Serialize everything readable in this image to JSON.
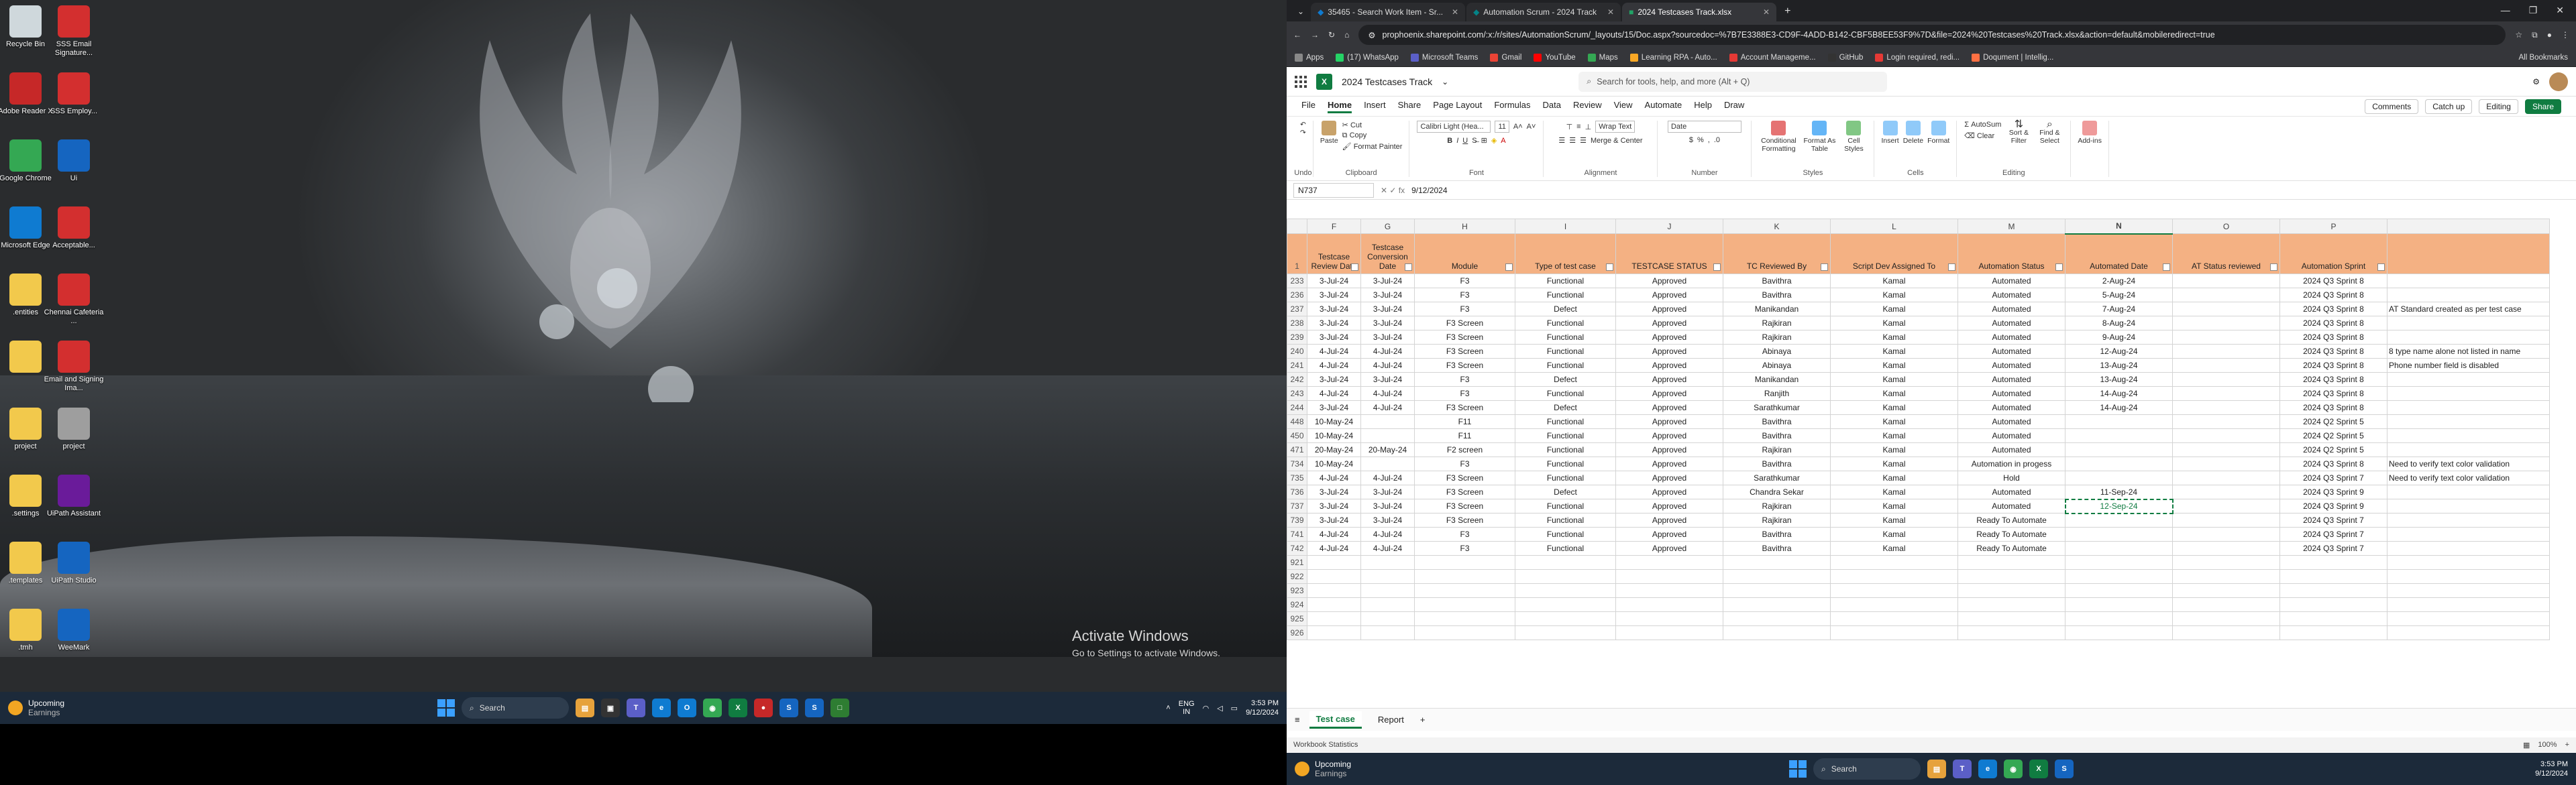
{
  "left_desktop": {
    "icons": [
      {
        "label": "Recycle Bin",
        "icon": "recycle-bin-icon",
        "color": "#cfd8dc"
      },
      {
        "label": "SSS Email Signature...",
        "icon": "pdf-icon",
        "color": "#d32f2f"
      },
      {
        "label": "Adobe Reader X",
        "icon": "adobe-reader-icon",
        "color": "#c62828"
      },
      {
        "label": "SSS Employ...",
        "icon": "pdf-icon",
        "color": "#d32f2f"
      },
      {
        "label": "Google Chrome",
        "icon": "chrome-icon",
        "color": "#34a853"
      },
      {
        "label": "Ui",
        "icon": "uipath-icon",
        "color": "#1565c0"
      },
      {
        "label": "Microsoft Edge",
        "icon": "edge-icon",
        "color": "#0f7bd1"
      },
      {
        "label": "Acceptable...",
        "icon": "pdf-icon",
        "color": "#d32f2f"
      },
      {
        "label": ".entities",
        "icon": "folder-icon",
        "color": "#f2c94c"
      },
      {
        "label": "Chennai Cafeteria ...",
        "icon": "pdf-icon",
        "color": "#d32f2f"
      },
      {
        "label": "",
        "icon": "folder-icon",
        "color": "#f2c94c"
      },
      {
        "label": "Email and Signing Ima...",
        "icon": "pdf-icon",
        "color": "#d32f2f"
      },
      {
        "label": "project",
        "icon": "folder-icon",
        "color": "#f2c94c"
      },
      {
        "label": "project",
        "icon": "file-icon",
        "color": "#9e9e9e"
      },
      {
        "label": ".settings",
        "icon": "folder-icon",
        "color": "#f2c94c"
      },
      {
        "label": "UiPath Assistant",
        "icon": "uipath-assistant-icon",
        "color": "#6a1b9a"
      },
      {
        "label": ".templates",
        "icon": "folder-icon",
        "color": "#f2c94c"
      },
      {
        "label": "UiPath Studio",
        "icon": "uipath-studio-icon",
        "color": "#1565c0"
      },
      {
        "label": ".tmh",
        "icon": "folder-icon",
        "color": "#f2c94c"
      },
      {
        "label": "WeeMark",
        "icon": "uipath-icon",
        "color": "#1565c0"
      }
    ],
    "activate_title": "Activate Windows",
    "activate_sub": "Go to Settings to activate Windows.",
    "taskbar": {
      "weather_title": "Upcoming",
      "weather_sub": "Earnings",
      "search": "Search",
      "lang": "ENG",
      "lang2": "IN",
      "time": "3:53 PM",
      "date": "9/12/2024"
    }
  },
  "browser": {
    "tabs": [
      {
        "label": "35465 - Search Work Item - Sr..."
      },
      {
        "label": "Automation Scrum - 2024 Track"
      },
      {
        "label": "2024 Testcases Track.xlsx"
      }
    ],
    "url": "prophoenix.sharepoint.com/:x:/r/sites/AutomationScrum/_layouts/15/Doc.aspx?sourcedoc=%7B7E3388E3-CD9F-4ADD-B142-CBF5B8EE53F9%7D&file=2024%20Testcases%20Track.xlsx&action=default&mobileredirect=true",
    "bookmarks": [
      "Apps",
      "(17) WhatsApp",
      "Microsoft Teams",
      "Gmail",
      "YouTube",
      "Maps",
      "Learning RPA - Auto...",
      "Account Manageme...",
      "GitHub",
      "Login required, redi...",
      "Doqument | Intellig..."
    ],
    "all_bookmarks": "All Bookmarks"
  },
  "excel": {
    "title": "2024 Testcases Track",
    "search_placeholder": "Search for tools, help, and more (Alt + Q)",
    "menu": [
      "File",
      "Home",
      "Insert",
      "Share",
      "Page Layout",
      "Formulas",
      "Data",
      "Review",
      "View",
      "Automate",
      "Help",
      "Draw"
    ],
    "menu_right": {
      "comments": "Comments",
      "catchup": "Catch up",
      "editing": "Editing",
      "share": "Share"
    },
    "ribbon": {
      "undo": "Undo",
      "paste": "Paste",
      "cut": "Cut",
      "copy": "Copy",
      "format_painter": "Format Painter",
      "clipboard": "Clipboard",
      "font_name": "Calibri Light (Hea...",
      "font_size": "11",
      "font": "Font",
      "wrap_text": "Wrap Text",
      "merge_center": "Merge & Center",
      "alignment": "Alignment",
      "number_format": "Date",
      "number": "Number",
      "cond_format": "Conditional Formatting",
      "format_table": "Format As Table",
      "cell_styles": "Cell Styles",
      "styles": "Styles",
      "insert": "Insert",
      "delete": "Delete",
      "format": "Format",
      "cells": "Cells",
      "autosum": "AutoSum",
      "clear": "Clear",
      "sort_filter": "Sort & Filter",
      "find_select": "Find & Select",
      "editing": "Editing",
      "addins": "Add-ins"
    },
    "namebox": "N737",
    "formula": "9/12/2024",
    "columns": [
      "F",
      "G",
      "H",
      "I",
      "J",
      "K",
      "L",
      "M",
      "N",
      "O",
      "P"
    ],
    "headers": [
      "Testcase Review Date",
      "Testcase Conversion Date",
      "Module",
      "Type of test case",
      "TESTCASE STATUS",
      "TC Reviewed By",
      "Script Dev Assigned To",
      "Automation Status",
      "Automated Date",
      "AT Status reviewed",
      "Automation Sprint",
      ""
    ],
    "rows": [
      [
        "233",
        "3-Jul-24",
        "3-Jul-24",
        "F3",
        "Functional",
        "Approved",
        "Bavithra",
        "Kamal",
        "Automated",
        "2-Aug-24",
        "",
        "2024 Q3 Sprint 8",
        ""
      ],
      [
        "236",
        "3-Jul-24",
        "3-Jul-24",
        "F3",
        "Functional",
        "Approved",
        "Bavithra",
        "Kamal",
        "Automated",
        "5-Aug-24",
        "",
        "2024 Q3 Sprint 8",
        ""
      ],
      [
        "237",
        "3-Jul-24",
        "3-Jul-24",
        "F3",
        "Defect",
        "Approved",
        "Manikandan",
        "Kamal",
        "Automated",
        "7-Aug-24",
        "",
        "2024 Q3 Sprint 8",
        "AT Standard created as per test case"
      ],
      [
        "238",
        "3-Jul-24",
        "3-Jul-24",
        "F3 Screen",
        "Functional",
        "Approved",
        "Rajkiran",
        "Kamal",
        "Automated",
        "8-Aug-24",
        "",
        "2024 Q3 Sprint 8",
        ""
      ],
      [
        "239",
        "3-Jul-24",
        "3-Jul-24",
        "F3 Screen",
        "Functional",
        "Approved",
        "Rajkiran",
        "Kamal",
        "Automated",
        "9-Aug-24",
        "",
        "2024 Q3 Sprint 8",
        ""
      ],
      [
        "240",
        "4-Jul-24",
        "4-Jul-24",
        "F3 Screen",
        "Functional",
        "Approved",
        "Abinaya",
        "Kamal",
        "Automated",
        "12-Aug-24",
        "",
        "2024 Q3 Sprint 8",
        "8 type name alone not listed in name"
      ],
      [
        "241",
        "4-Jul-24",
        "4-Jul-24",
        "F3 Screen",
        "Functional",
        "Approved",
        "Abinaya",
        "Kamal",
        "Automated",
        "13-Aug-24",
        "",
        "2024 Q3 Sprint 8",
        "Phone number field is disabled"
      ],
      [
        "242",
        "3-Jul-24",
        "3-Jul-24",
        "F3",
        "Defect",
        "Approved",
        "Manikandan",
        "Kamal",
        "Automated",
        "13-Aug-24",
        "",
        "2024 Q3 Sprint 8",
        ""
      ],
      [
        "243",
        "4-Jul-24",
        "4-Jul-24",
        "F3",
        "Functional",
        "Approved",
        "Ranjith",
        "Kamal",
        "Automated",
        "14-Aug-24",
        "",
        "2024 Q3 Sprint 8",
        ""
      ],
      [
        "244",
        "3-Jul-24",
        "4-Jul-24",
        "F3 Screen",
        "Defect",
        "Approved",
        "Sarathkumar",
        "Kamal",
        "Automated",
        "14-Aug-24",
        "",
        "2024 Q3 Sprint 8",
        ""
      ],
      [
        "448",
        "10-May-24",
        "",
        "F11",
        "Functional",
        "Approved",
        "Bavithra",
        "Kamal",
        "Automated",
        "",
        "",
        "2024 Q2 Sprint 5",
        ""
      ],
      [
        "450",
        "10-May-24",
        "",
        "F11",
        "Functional",
        "Approved",
        "Bavithra",
        "Kamal",
        "Automated",
        "",
        "",
        "2024 Q2 Sprint 5",
        ""
      ],
      [
        "471",
        "20-May-24",
        "20-May-24",
        "F2 screen",
        "Functional",
        "Approved",
        "Rajkiran",
        "Kamal",
        "Automated",
        "",
        "",
        "2024 Q2 Sprint 5",
        ""
      ],
      [
        "734",
        "10-May-24",
        "",
        "F3",
        "Functional",
        "Approved",
        "Bavithra",
        "Kamal",
        "Automation in progess",
        "",
        "",
        "2024 Q3 Sprint 8",
        "Need to verify text color validation"
      ],
      [
        "735",
        "4-Jul-24",
        "4-Jul-24",
        "F3 Screen",
        "Functional",
        "Approved",
        "Sarathkumar",
        "Kamal",
        "Hold",
        "",
        "",
        "2024 Q3 Sprint 7",
        "Need to verify text color validation"
      ],
      [
        "736",
        "3-Jul-24",
        "3-Jul-24",
        "F3 Screen",
        "Defect",
        "Approved",
        "Chandra Sekar",
        "Kamal",
        "Automated",
        "11-Sep-24",
        "",
        "2024 Q3 Sprint 9",
        ""
      ],
      [
        "737",
        "3-Jul-24",
        "3-Jul-24",
        "F3 Screen",
        "Functional",
        "Approved",
        "Rajkiran",
        "Kamal",
        "Automated",
        "12-Sep-24",
        "",
        "2024 Q3 Sprint 9",
        ""
      ],
      [
        "739",
        "3-Jul-24",
        "3-Jul-24",
        "F3 Screen",
        "Functional",
        "Approved",
        "Rajkiran",
        "Kamal",
        "Ready To Automate",
        "",
        "",
        "2024 Q3 Sprint 7",
        ""
      ],
      [
        "741",
        "4-Jul-24",
        "4-Jul-24",
        "F3",
        "Functional",
        "Approved",
        "Bavithra",
        "Kamal",
        "Ready To Automate",
        "",
        "",
        "2024 Q3 Sprint 7",
        ""
      ],
      [
        "742",
        "4-Jul-24",
        "4-Jul-24",
        "F3",
        "Functional",
        "Approved",
        "Bavithra",
        "Kamal",
        "Ready To Automate",
        "",
        "",
        "2024 Q3 Sprint 7",
        ""
      ],
      [
        "921",
        "",
        "",
        "",
        "",
        "",
        "",
        "",
        "",
        "",
        "",
        "",
        ""
      ],
      [
        "922",
        "",
        "",
        "",
        "",
        "",
        "",
        "",
        "",
        "",
        "",
        "",
        ""
      ],
      [
        "923",
        "",
        "",
        "",
        "",
        "",
        "",
        "",
        "",
        "",
        "",
        "",
        ""
      ],
      [
        "924",
        "",
        "",
        "",
        "",
        "",
        "",
        "",
        "",
        "",
        "",
        "",
        ""
      ],
      [
        "925",
        "",
        "",
        "",
        "",
        "",
        "",
        "",
        "",
        "",
        "",
        "",
        ""
      ],
      [
        "926",
        "",
        "",
        "",
        "",
        "",
        "",
        "",
        "",
        "",
        "",
        "",
        ""
      ]
    ],
    "sheets": [
      "Test case",
      "Report"
    ],
    "status_left": "Workbook Statistics",
    "zoom": "100%",
    "taskbar": {
      "weather_title": "Upcoming",
      "weather_sub": "Earnings",
      "search": "Search",
      "time": "3:53 PM",
      "date": "9/12/2024"
    }
  }
}
